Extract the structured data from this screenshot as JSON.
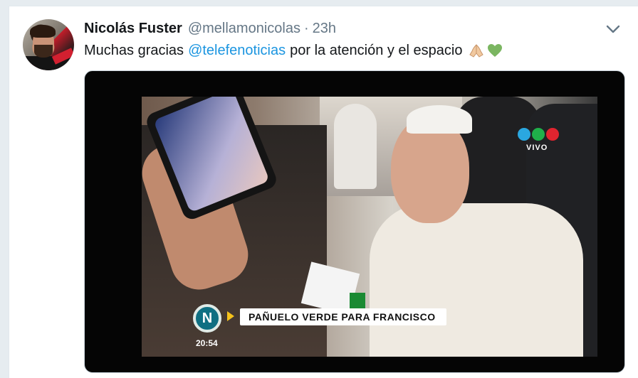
{
  "tweet": {
    "display_name": "Nicolás Fuster",
    "handle": "@mellamonicolas",
    "separator": "·",
    "time": "23h",
    "text_before": "Muchas gracias",
    "mention": "@telefenoticias",
    "text_after": "por la atención y el espacio",
    "emojis": [
      "pray-icon",
      "green-heart-icon"
    ],
    "menu_icon": "chevron-down-icon"
  },
  "media": {
    "network_logo_text": "VIVO",
    "channel_badge": "N",
    "clock": "20:54",
    "ticker": "PAÑUELO VERDE PARA FRANCISCO",
    "logo_colors": [
      "#2aa7e0",
      "#1fb04a",
      "#e0242f"
    ]
  },
  "colors": {
    "link": "#1b95e0",
    "text": "#14171a",
    "muted": "#657786"
  }
}
